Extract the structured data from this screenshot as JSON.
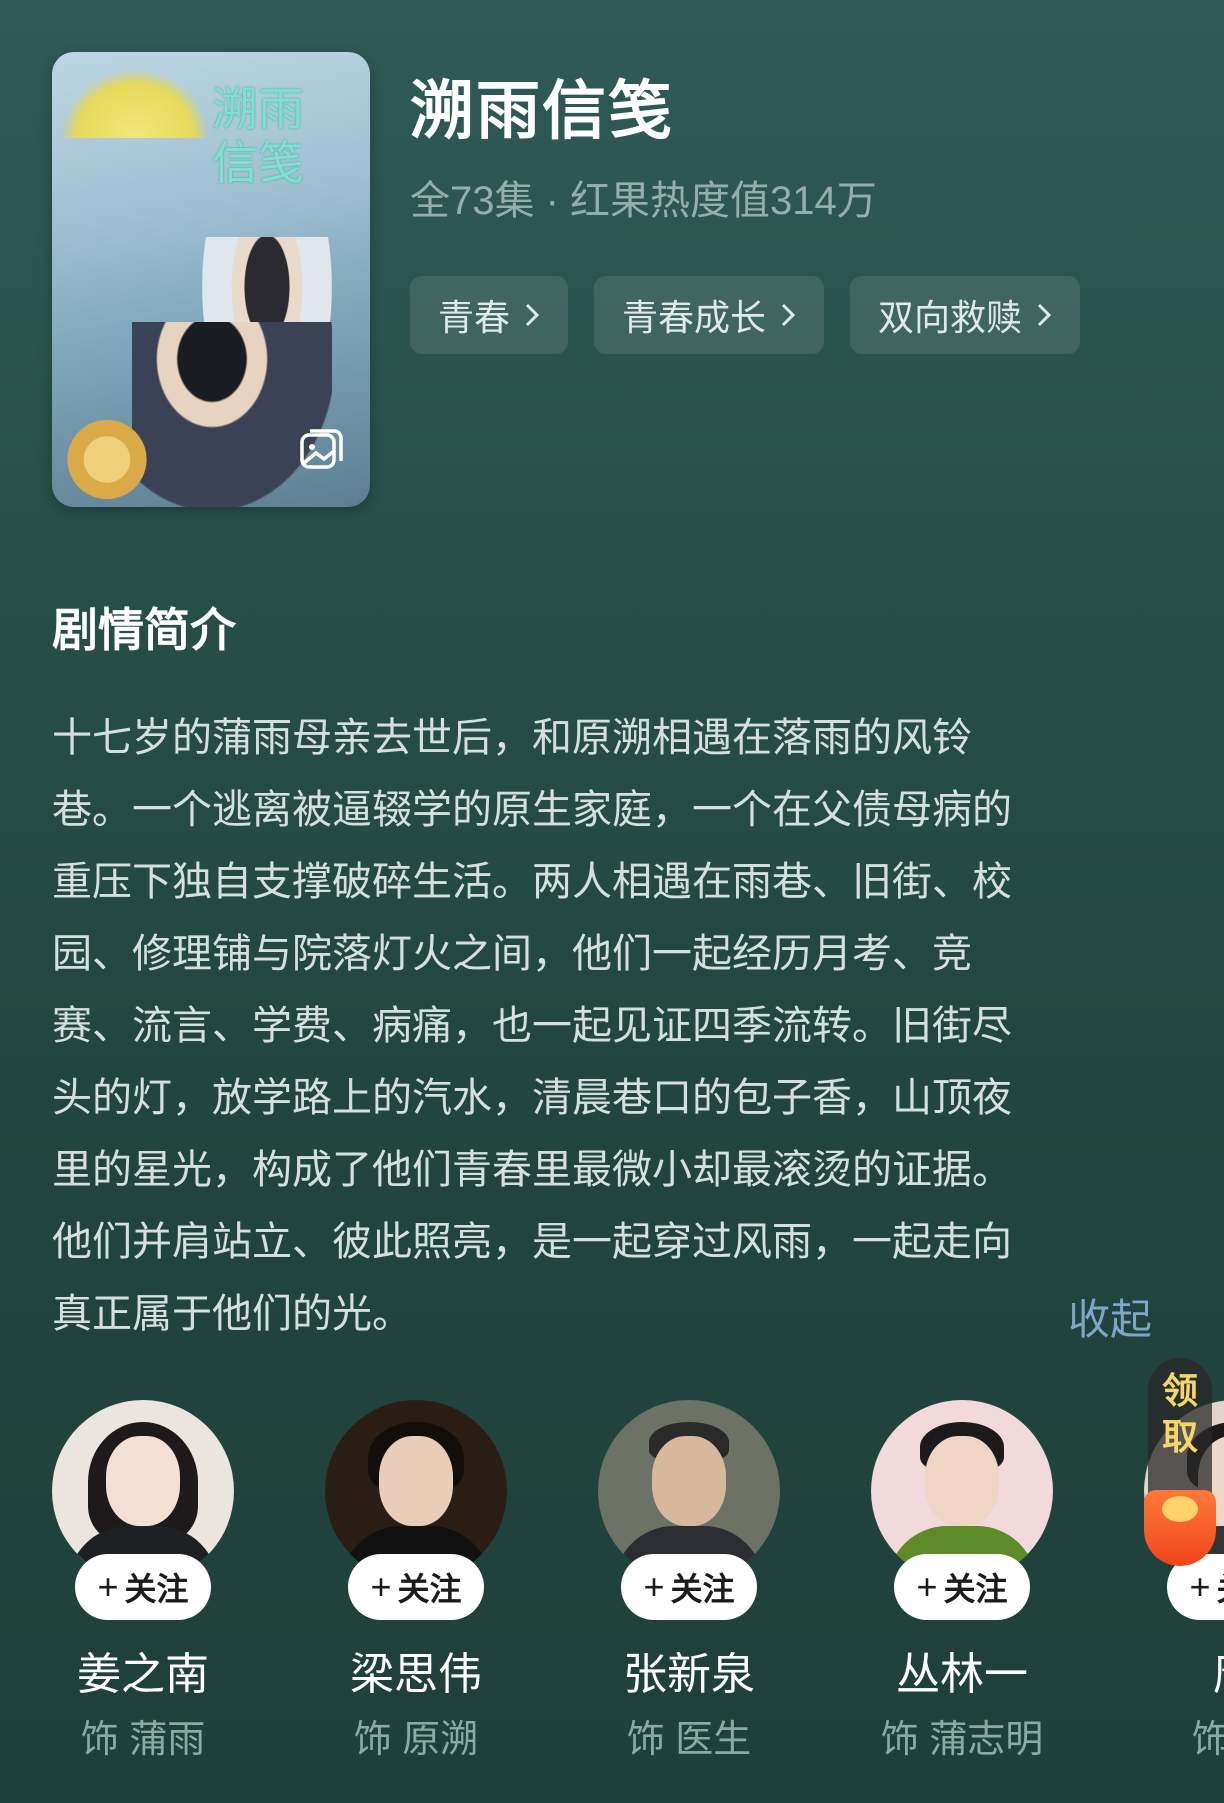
{
  "title": "溯雨信笺",
  "meta": "全73集 · 红果热度值314万",
  "poster": {
    "title_art": "溯雨\n信笺"
  },
  "tags": [
    {
      "label": "青春"
    },
    {
      "label": "青春成长"
    },
    {
      "label": "双向救赎"
    }
  ],
  "synopsis": {
    "heading": "剧情简介",
    "lines": [
      "十七岁的蒲雨母亲去世后，和原溯相遇在落雨的风铃",
      "巷。一个逃离被逼辍学的原生家庭，一个在父债母病的",
      "重压下独自支撑破碎生活。两人相遇在雨巷、旧街、校",
      "园、修理铺与院落灯火之间，他们一起经历月考、竞",
      "赛、流言、学费、病痛，也一起见证四季流转。旧街尽",
      "头的灯，放学路上的汽水，清晨巷口的包子香，山顶夜",
      "里的星光，构成了他们青春里最微小却最滚烫的证据。",
      "他们并肩站立、彼此照亮，是一起穿过风雨，一起走向",
      "真正属于他们的光。"
    ],
    "collapse_label": "收起"
  },
  "cast": [
    {
      "name": "姜之南",
      "role": "饰 蒲雨",
      "follow_label": "关注"
    },
    {
      "name": "梁思伟",
      "role": "饰 原溯",
      "follow_label": "关注"
    },
    {
      "name": "张新泉",
      "role": "饰 医生",
      "follow_label": "关注"
    },
    {
      "name": "丛林一",
      "role": "饰 蒲志明",
      "follow_label": "关注"
    },
    {
      "name": "唐",
      "role": "饰 许",
      "follow_label": "关注"
    }
  ],
  "promo": {
    "label": "领取"
  },
  "colors": {
    "accent_link": "#7ea6c8",
    "background": "#275049"
  }
}
